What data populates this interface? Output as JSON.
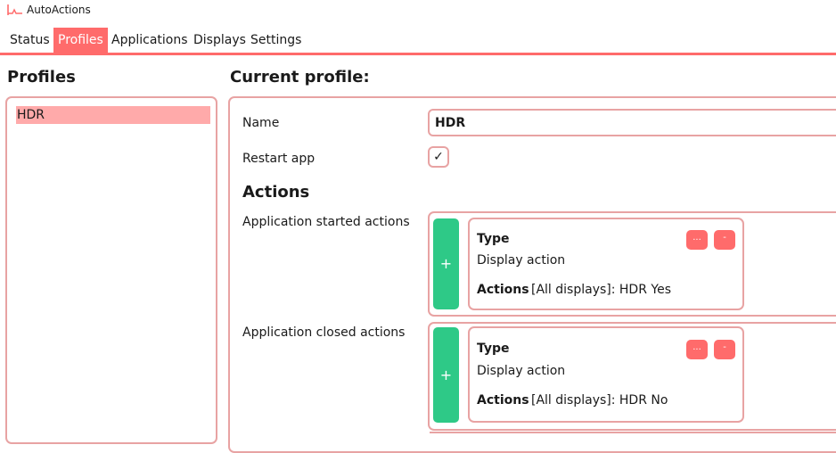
{
  "app": {
    "title": "AutoActions",
    "icon": "app-logo-icon"
  },
  "tabs": [
    {
      "label": "Status",
      "active": false
    },
    {
      "label": "Profiles",
      "active": true
    },
    {
      "label": "Applications",
      "active": false
    },
    {
      "label": "Displays",
      "active": false
    },
    {
      "label": "Settings",
      "active": false
    }
  ],
  "profiles": {
    "heading": "Profiles",
    "items": [
      {
        "label": "HDR",
        "selected": true
      }
    ]
  },
  "current_profile": {
    "heading": "Current profile:",
    "name_label": "Name",
    "name_value": "HDR",
    "restart_label": "Restart app",
    "restart_checked": true,
    "restart_mark": "✓",
    "actions_heading": "Actions",
    "started": {
      "label": "Application started actions",
      "add_label": "+",
      "card": {
        "type_label": "Type",
        "type_value": "Display action",
        "actions_label": "Actions",
        "actions_value": "[All displays]: HDR Yes",
        "edit_label": "...",
        "remove_label": "-"
      }
    },
    "closed": {
      "label": "Application closed actions",
      "add_label": "+",
      "card": {
        "type_label": "Type",
        "type_value": "Display action",
        "actions_label": "Actions",
        "actions_value": "[All displays]: HDR No",
        "edit_label": "...",
        "remove_label": "-"
      }
    }
  },
  "colors": {
    "accent": "#ff6b6b",
    "selected_bg": "#ffaaaa",
    "border": "#e8a3a3",
    "add_green": "#2ec987"
  }
}
